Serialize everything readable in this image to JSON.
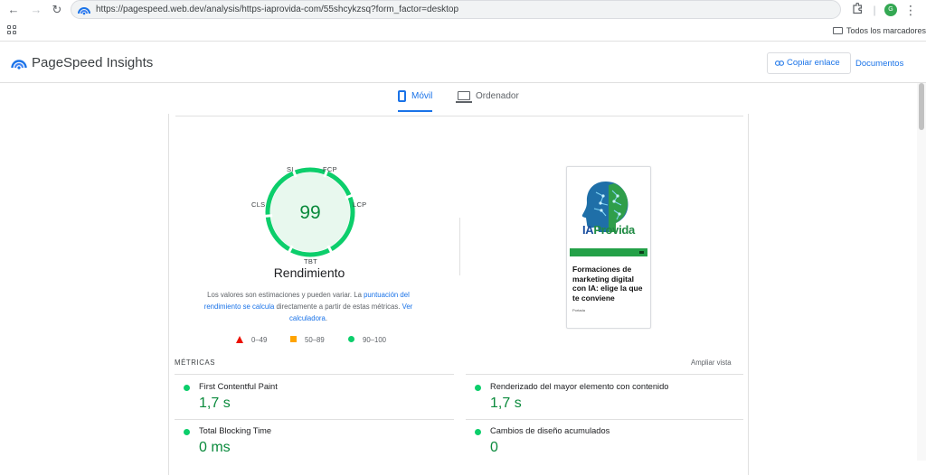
{
  "browser": {
    "url": "https://pagespeed.web.dev/analysis/https-iaprovida-com/55shcykzsq?form_factor=desktop",
    "avatar_letter": "G",
    "bookmarks_all": "Todos los marcadores"
  },
  "header": {
    "title": "PageSpeed Insights",
    "copy_link": "Copiar enlace",
    "docs": "Documentos"
  },
  "tabs": [
    {
      "label": "Móvil",
      "active": true
    },
    {
      "label": "Ordenador",
      "active": false
    }
  ],
  "performance": {
    "score": "99",
    "gauge_labels": {
      "si": "SI",
      "fcp": "FCP",
      "cls": "CLS",
      "lcp": "LCP",
      "tbt": "TBT"
    },
    "title": "Rendimiento",
    "desc_before": "Los valores son estimaciones y pueden variar. La ",
    "desc_link1": "puntuación del rendimiento se calcula",
    "desc_middle": " directamente a partir de estas métricas. ",
    "desc_link2": "Ver calculadora",
    "desc_after": ".",
    "colors": {
      "pass": "#0cce6b",
      "average": "#ffa400",
      "fail": "#eb0f00"
    }
  },
  "legend": [
    {
      "range": "0–49",
      "shape": "triangle"
    },
    {
      "range": "50–89",
      "shape": "square"
    },
    {
      "range": "90–100",
      "shape": "circle"
    }
  ],
  "screenshot": {
    "brand_ia": "IA",
    "brand_provida": "Provida",
    "heading": "Formaciones de marketing digital con IA: elige la que te conviene",
    "small": "Portada"
  },
  "metrics": {
    "heading": "MÉTRICAS",
    "expand": "Ampliar vista",
    "items": [
      {
        "name": "First Contentful Paint",
        "value": "1,7 s"
      },
      {
        "name": "Renderizado del mayor elemento con contenido",
        "value": "1,7 s"
      },
      {
        "name": "Total Blocking Time",
        "value": "0 ms"
      },
      {
        "name": "Cambios de diseño acumulados",
        "value": "0"
      }
    ]
  }
}
